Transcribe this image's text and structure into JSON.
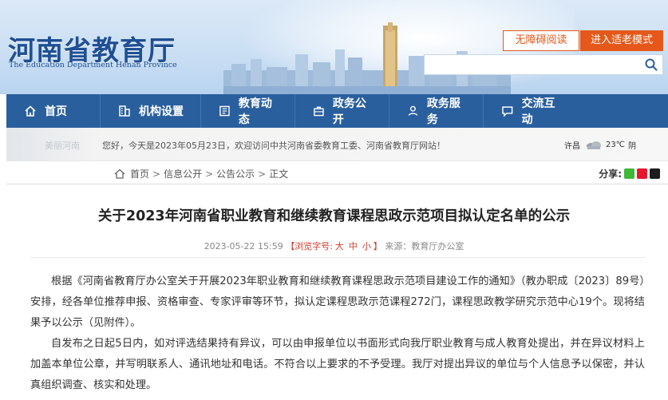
{
  "header": {
    "title": "河南省教育厅",
    "subtitle": "The Education Department Henan Province",
    "a11y_button": "无障碍阅读",
    "elder_button": "进入适老模式",
    "search_placeholder": ""
  },
  "nav": {
    "items": [
      {
        "label": "首页",
        "icon": "home-icon"
      },
      {
        "label": "机构设置",
        "icon": "building-icon"
      },
      {
        "label": "教育动态",
        "icon": "news-icon"
      },
      {
        "label": "政务公开",
        "icon": "briefcase-icon"
      },
      {
        "label": "政务服务",
        "icon": "service-icon"
      },
      {
        "label": "交流互动",
        "icon": "chat-icon"
      }
    ]
  },
  "welcome": {
    "prefix": "您好，今天是",
    "date": "2023年05月23日",
    "suffix": "，欢迎访问中共河南省委教育工委、河南省教育厅网站！",
    "deco_text": "美丽河南"
  },
  "weather": {
    "city": "许昌",
    "temp": "23℃",
    "condition": "阴"
  },
  "breadcrumb": {
    "items": [
      "首页",
      "信息公开",
      "公告公示",
      "正文"
    ]
  },
  "share": {
    "label": "分享:"
  },
  "article": {
    "title": "关于2023年河南省职业教育和继续教育课程思政示范项目拟认定名单的公示",
    "datetime": "2023-05-22 15:59",
    "font_prefix": "【浏览字号:",
    "font_large": "大",
    "font_medium": "中",
    "font_small": "小",
    "font_suffix": "】",
    "source": "来源：教育厅办公室",
    "paragraphs": [
      "根据《河南省教育厅办公室关于开展2023年职业教育和继续教育课程思政示范项目建设工作的通知》（教办职成〔2023〕89号）安排，经各单位推荐申报、资格审查、专家评审等环节，拟认定课程思政示范课程272门，课程思政教学研究示范中心19个。现将结果予以公示（见附件）。",
      "自发布之日起5日内，如对评选结果持有异议，可以由申报单位以书面形式向我厅职业教育与成人教育处提出，并在异议材料上加盖本单位公章，并写明联系人、通讯地址和电话。不符合以上要求的不予受理。我厅对提出异议的单位与个人信息予以保密，并认真组织调查、核实和处理。"
    ]
  },
  "colors": {
    "nav_bg": "#2a5f9e",
    "accent": "#e5581a",
    "title_blue": "#1f4f94",
    "font_size_red": "#d43a2a"
  }
}
